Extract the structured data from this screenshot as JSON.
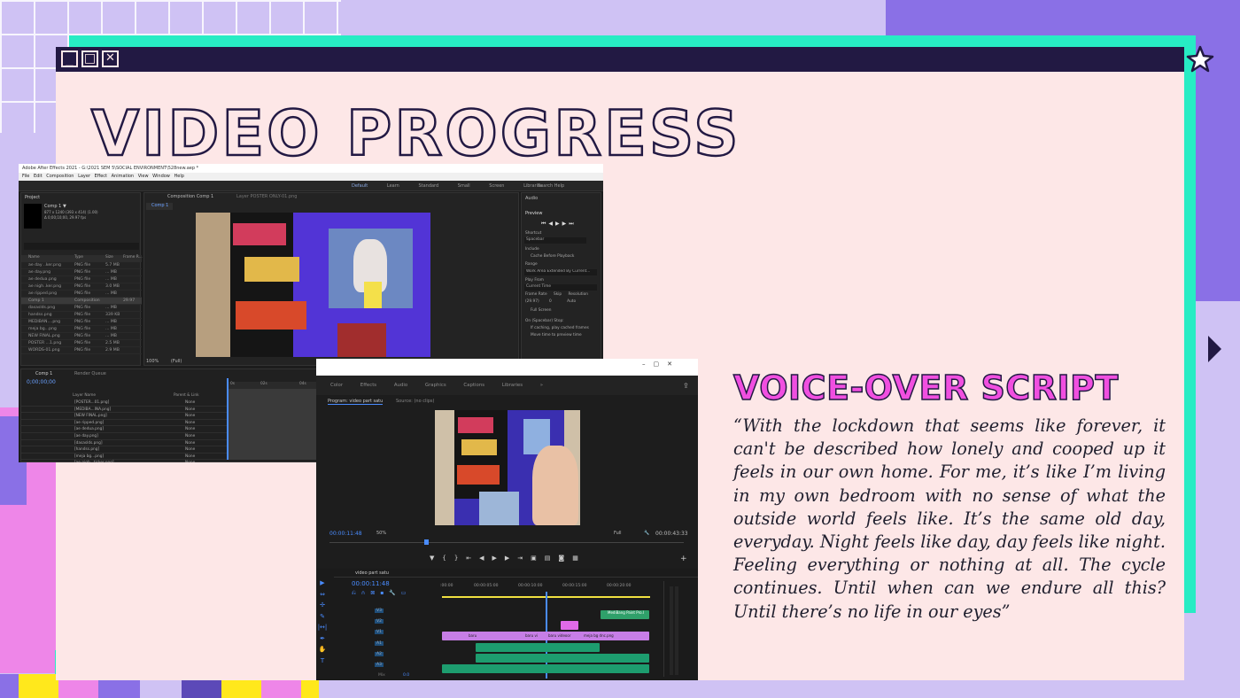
{
  "page": {
    "title": "VIDEO PROGRESS",
    "voiceover_heading": "VOICE-OVER SCRIPT",
    "voiceover_text": "“With the lockdown that seems like forever, it can't be described how lonely and cooped up it feels in our own home. For me, it’s like I’m living in my own bedroom with no sense of what the outside world feels like. It’s the same old day, everyday. Night feels like day, day feels like night. Feeling everything or nothing at all. The cycle continues. Until when can we endure all this? Until there’s no life in our eyes”"
  },
  "window_controls": {
    "minimize": "_",
    "maximize": "□",
    "close": "✕"
  },
  "colors": {
    "background": "#cfc2f4",
    "accent_purple": "#8a70e6",
    "accent_teal": "#27ecc4",
    "accent_pink": "#ee86e8",
    "accent_yellow": "#ffe81c",
    "window_bg": "#fde7e7",
    "titlebar": "#221943",
    "heading_pink": "#f04fe0"
  },
  "after_effects": {
    "window_title": "Adobe After Effects 2021 - G:\\2021 SEM 5\\SOCIAL ENVIRONMENT\\528new.aep *",
    "menu": [
      "File",
      "Edit",
      "Composition",
      "Layer",
      "Effect",
      "Animation",
      "View",
      "Window",
      "Help"
    ],
    "workspaces": [
      "Default",
      "Learn",
      "Standard",
      "Small Screen",
      "Libraries"
    ],
    "search_placeholder": "Search Help",
    "project_label": "Project",
    "comp_name": "Comp 1 ▼",
    "comp_info": "877 x 1240 (393 x 414) (1.00)",
    "comp_duration": "Δ 0;00;10;00, 29.97 fps",
    "composition_tab": "Composition Comp 1",
    "layer_tab": "Layer POSTER ONLY-01.png",
    "comp_sub_tab": "Comp 1",
    "project_columns": [
      "Name",
      "Type",
      "Size",
      "Frame R..."
    ],
    "project_items": [
      [
        "ae day ..ker.png",
        "PNG file",
        "5.7 MB",
        ""
      ],
      [
        "ae day.png",
        "PNG file",
        "... MB",
        ""
      ],
      [
        "ae dedua.png",
        "PNG file",
        "... MB",
        ""
      ],
      [
        "ae nigh..ker.png",
        "PNG file",
        "3.0 MB",
        ""
      ],
      [
        "ae ripped.png",
        "PNG file",
        "... MB",
        ""
      ],
      [
        "Comp 1",
        "Composition",
        "",
        "29.97"
      ],
      [
        "dasaslds.png",
        "PNG file",
        "... MB",
        ""
      ],
      [
        "handss.png",
        "PNG file",
        "339 KB",
        ""
      ],
      [
        "MEDIBAN....png",
        "PNG file",
        "... MB",
        ""
      ],
      [
        "meja bg...png",
        "PNG file",
        "... MB",
        ""
      ],
      [
        "NEW FINAL.png",
        "PNG file",
        "... MB",
        ""
      ],
      [
        "POSTER ...1.png",
        "PNG file",
        "2.5 MB",
        ""
      ],
      [
        "WORDS-01.png",
        "PNG file",
        "2.9 MB",
        ""
      ]
    ],
    "audio_label": "Audio",
    "preview_label": "Preview",
    "shortcut_label": "Shortcut",
    "shortcut_value": "Spacebar",
    "include_label": "Include",
    "cache_label": "Cache Before Playback",
    "range_label": "Range",
    "range_value": "Work Area Extended By Current...",
    "play_from_label": "Play From",
    "play_from_value": "Current Time",
    "frame_rate_label": "Frame Rate",
    "skip_label": "Skip",
    "resolution_label": "Resolution",
    "frame_rate_value": "(29.97)",
    "skip_value": "0",
    "resolution_value": "Auto",
    "full_screen": "Full Screen",
    "on_stop": "On (Spacebar) Stop:",
    "if_caching": "If caching, play cached frames",
    "move_time": "Move time to preview time",
    "zoom": "100%",
    "quality": "(Full)",
    "timeline_tab": "Comp 1",
    "render_queue_tab": "Render Queue",
    "timecode": "0;00;00;00",
    "layer_header": "Layer Name",
    "parent_header": "Parent & Link",
    "layers": [
      "[POSTER...01.png]",
      "[MEDIBA...INA.png]",
      "[NEW FINAL.png]",
      "[ae ripped.png]",
      "[ae dedua.png]",
      "[ae day.png]",
      "[dasaslds.png]",
      "[handss.png]",
      "[meja bg...png]",
      "[ae nigh...ticker.png]",
      "[ae day sticker.png]"
    ],
    "parent_value": "None",
    "ruler": [
      "0s",
      "02s",
      "04s"
    ],
    "toggle_label": "Toggle Switches / Modes"
  },
  "premiere": {
    "workspaces": [
      "Color",
      "Effects",
      "Audio",
      "Graphics",
      "Captions",
      "Libraries",
      "»"
    ],
    "program_tab": "Program: video part satu",
    "source_tab": "Source: (no clips)",
    "current_time": "00:00:11:48",
    "zoom": "50%",
    "quality": "Full",
    "duration": "00:00:43:33",
    "sequence_tab": "video part satu",
    "sequence_time": "00:00:11:48",
    "ruler": [
      ":00:00",
      "00:00:05:00",
      "00:00:10:00",
      "00:00:15:00",
      "00:00:20:00"
    ],
    "tracks_video": [
      "V3",
      "V2",
      "V1"
    ],
    "tracks_audio": [
      "A1",
      "A2",
      "A3"
    ],
    "mix_label": "Mix",
    "mix_value": "0.0",
    "clip_labels": [
      "MediBang Paint Pro.l",
      "baru",
      "baru vi",
      "baru videoor",
      "meja bg dnc.png"
    ],
    "transport_icons": [
      "marker",
      "in",
      "out",
      "step-back",
      "play-back",
      "play",
      "step-fwd",
      "play-fwd",
      "insert",
      "overwrite",
      "camera",
      "multi",
      "add"
    ]
  }
}
